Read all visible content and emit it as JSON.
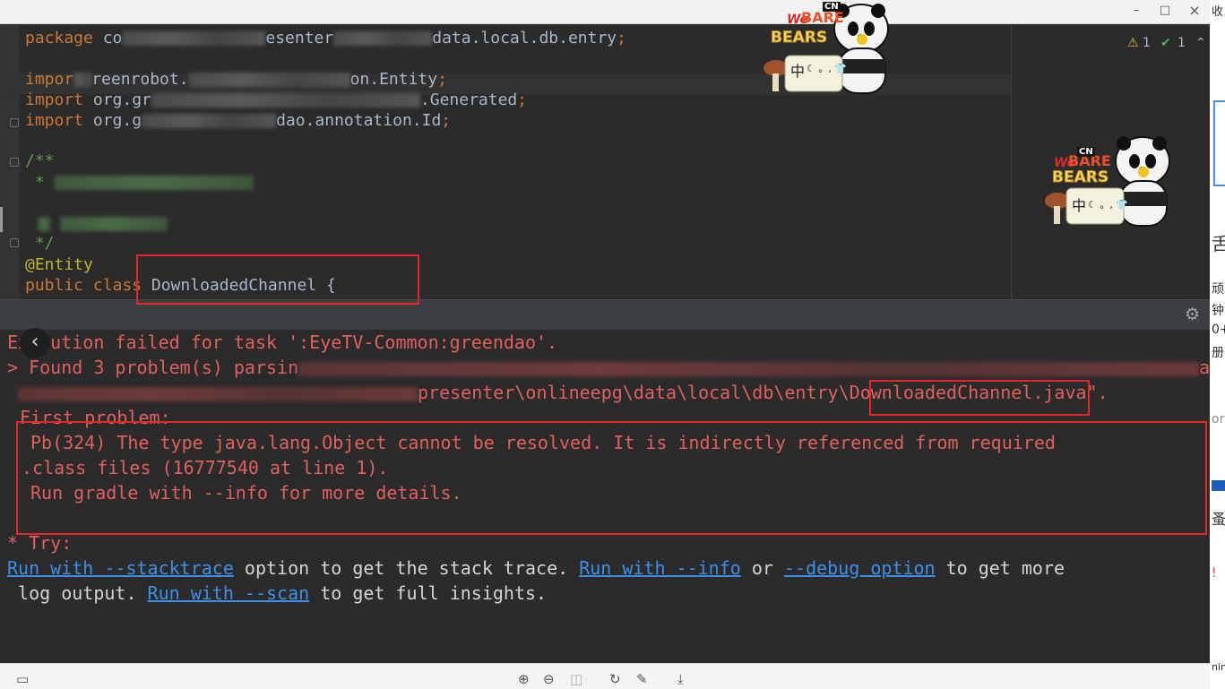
{
  "window": {
    "minimize": "–",
    "maximize": "□",
    "close": "×"
  },
  "right_strip": {
    "top_text": "收",
    "chars": [
      "舌",
      "顽",
      "钟",
      "0+",
      "册",
      "or",
      "蚤",
      "!",
      "nin"
    ]
  },
  "editor": {
    "lines": {
      "package_kw": "package",
      "package_a": " co",
      "package_b": "esenter",
      "package_c": "data.local.db.entry",
      "package_semi": ";",
      "import1_kw": "impor",
      "import1_a": "reenrobot.",
      "import1_b": "on.Entity",
      "import1_semi": ";",
      "import2_kw": "import",
      "import2_a": " org.gr",
      "import2_b": ".Generated",
      "import2_semi": ";",
      "import3_kw": "import",
      "import3_a": " org.g",
      "import3_b": "dao.annotation.Id",
      "import3_semi": ";",
      "doc_open": "/**",
      "doc_star1": " *",
      "doc_close": " */",
      "annotation": "@Entity",
      "class_public": "public ",
      "class_kw": "class",
      "class_name": " DownloadedChannel {"
    },
    "inspections": {
      "warnings": "1",
      "checks": "1"
    }
  },
  "stickers": {
    "brand_line1": "We",
    "brand_line2": "BARE",
    "brand_line3": "BEARS",
    "cn_badge": "CN",
    "sign_text": "中",
    "sign_icons": "☾ 。, 👕"
  },
  "console": {
    "line1": "Execution failed for task ':EyeTV-Common:greendao'.",
    "line2_a": "> Found 3 problem(s) parsin",
    "line2_b": "ain",
    "line3_a": "presenter\\onlineepg\\data\\local\\db\\entry",
    "line3_b": "\\DownloadedChannel.java\".",
    "line4": "First problem:",
    "line5": "Pb(324) The type java.lang.Object cannot be resolved. It is indirectly referenced from required",
    "line6": ".class files (16777540 at line 1).",
    "line7": "Run gradle with --info for more details.",
    "line8": "* Try:",
    "try_link1": "Run with --stacktrace",
    "try_text1": " option to get the stack trace. ",
    "try_link2": "Run with --info",
    "try_text2": " or ",
    "try_link3": "--debug option",
    "try_text3": " to get more",
    "try2_text1": " log output. ",
    "try_link4": "Run with --scan",
    "try2_text2": " to get full insights."
  },
  "colors": {
    "error": "#e0605f",
    "link": "#3d8fe8",
    "highlight_box": "#e8262a",
    "keyword": "#cc7832",
    "annotation": "#bbb529"
  }
}
